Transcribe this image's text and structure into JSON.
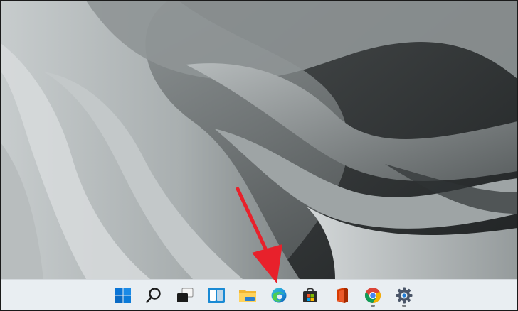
{
  "desktop": {
    "wallpaper_name": "windows-11-bloom-gray"
  },
  "taskbar": {
    "background": "#e9eef2",
    "items": [
      {
        "key": "start",
        "icon": "windows-start-icon",
        "running": false
      },
      {
        "key": "search",
        "icon": "search-icon",
        "running": false
      },
      {
        "key": "task-view",
        "icon": "task-view-icon",
        "running": false
      },
      {
        "key": "widgets",
        "icon": "widgets-icon",
        "running": false
      },
      {
        "key": "file-explorer",
        "icon": "file-explorer-icon",
        "running": false
      },
      {
        "key": "edge",
        "icon": "edge-browser-icon",
        "running": false
      },
      {
        "key": "store",
        "icon": "microsoft-store-icon",
        "running": false
      },
      {
        "key": "office",
        "icon": "office-icon",
        "running": false
      },
      {
        "key": "chrome",
        "icon": "chrome-icon",
        "running": true
      },
      {
        "key": "settings",
        "icon": "settings-gear-icon",
        "running": true
      }
    ]
  },
  "annotation": {
    "arrow_color": "#e8212b",
    "points_to": "edge-browser-icon"
  }
}
